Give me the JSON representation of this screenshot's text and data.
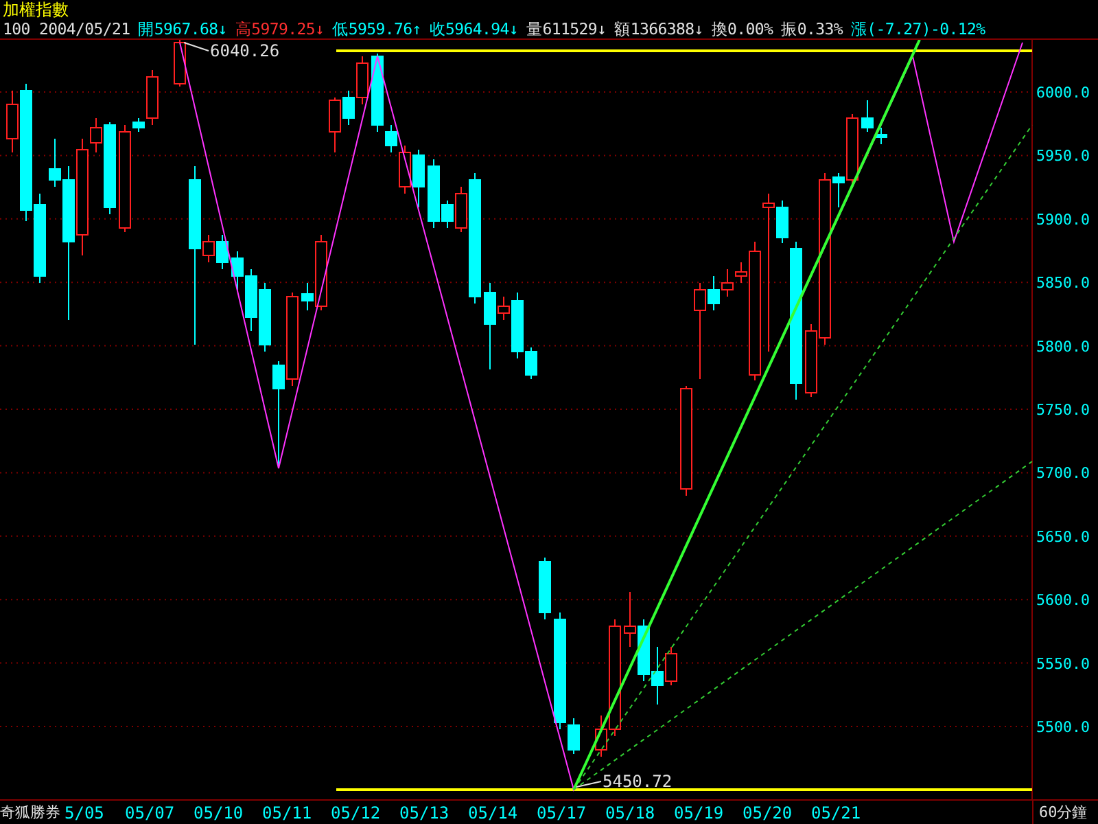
{
  "title": "加權指數",
  "quote": [
    {
      "text": "100 2004/05/21",
      "color": "#e0e0e0"
    },
    {
      "text": "開5967.68↓",
      "color": "#00ffff"
    },
    {
      "text": "高5979.25↓",
      "color": "#ff3030"
    },
    {
      "text": "低5959.76↑",
      "color": "#00ffff"
    },
    {
      "text": "收5964.94↓",
      "color": "#00ffff"
    },
    {
      "text": "量611529↓",
      "color": "#e0e0e0"
    },
    {
      "text": "額1366388↓",
      "color": "#e0e0e0"
    },
    {
      "text": "換0.00%",
      "color": "#e0e0e0"
    },
    {
      "text": "振0.33%",
      "color": "#e0e0e0"
    },
    {
      "text": "漲(-7.27)-0.12%",
      "color": "#00ffff"
    }
  ],
  "high_label": "6040.26",
  "low_label": "5450.72",
  "price_axis": [
    "6000.0",
    "5950.0",
    "5900.0",
    "5850.0",
    "5800.0",
    "5750.0",
    "5700.0",
    "5650.0",
    "5600.0",
    "5550.0",
    "5500.0"
  ],
  "footer": {
    "brand": "奇狐勝券",
    "dates": [
      "5/05",
      "05/07",
      "05/10",
      "05/11",
      "05/12",
      "05/13",
      "05/14",
      "05/17",
      "05/18",
      "05/19",
      "05/20",
      "05/21"
    ],
    "period": "60分鐘"
  }
}
